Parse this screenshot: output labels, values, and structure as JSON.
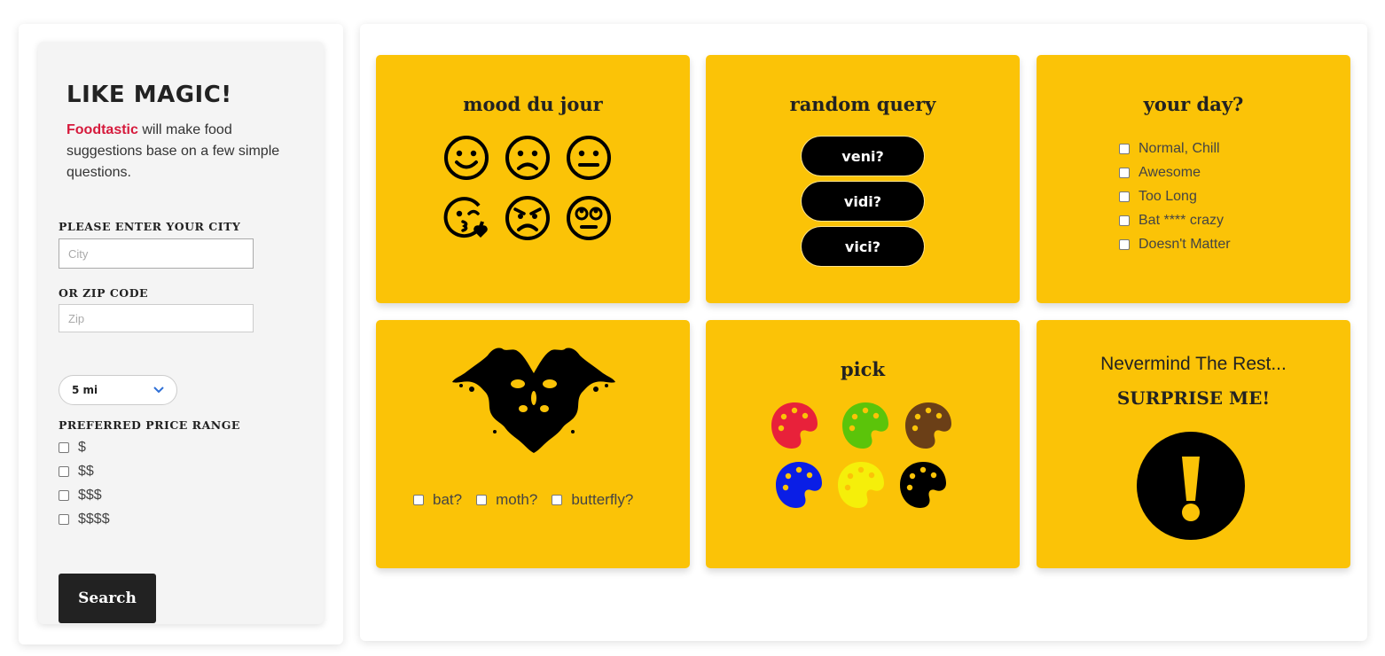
{
  "sidebar": {
    "title": "LIKE MAGIC!",
    "brand": "Foodtastic",
    "intro_rest": " will make food suggestions base on a few simple questions.",
    "city_label": "PLEASE ENTER YOUR CITY",
    "city_placeholder": "City",
    "zip_label": "OR ZIP CODE",
    "zip_placeholder": "Zip",
    "radius_value": "5 mi",
    "price_label": "PREFERRED PRICE RANGE",
    "price_options": [
      "$",
      "$$",
      "$$$",
      "$$$$"
    ],
    "search_label": "Search"
  },
  "cards": {
    "mood": {
      "title": "mood du jour",
      "icons": [
        "smile-icon",
        "frown-icon",
        "neutral-face-icon",
        "kiss-wink-heart-icon",
        "angry-icon",
        "rolling-eyes-icon"
      ]
    },
    "query": {
      "title": "random query",
      "buttons": [
        "veni?",
        "vidi?",
        "vici?"
      ]
    },
    "day": {
      "title": "your day?",
      "options": [
        "Normal, Chill",
        "Awesome",
        "Too Long",
        "Bat **** crazy",
        "Doesn't Matter"
      ]
    },
    "inkblot": {
      "options": [
        "bat?",
        "moth?",
        "butterfly?"
      ]
    },
    "pick": {
      "title": "pick",
      "palette_colors": [
        "#e8213a",
        "#5bc40a",
        "#6b3f17",
        "#0a1ee6",
        "#f5ef0a",
        "#000000"
      ]
    },
    "surprise": {
      "line1": "Nevermind The Rest...",
      "line2": "SURPRISE ME!",
      "icon": "exclamation-circle-icon"
    }
  },
  "colors": {
    "card_bg": "#fbc307",
    "brand": "#d61a3c",
    "dark": "#222222"
  }
}
